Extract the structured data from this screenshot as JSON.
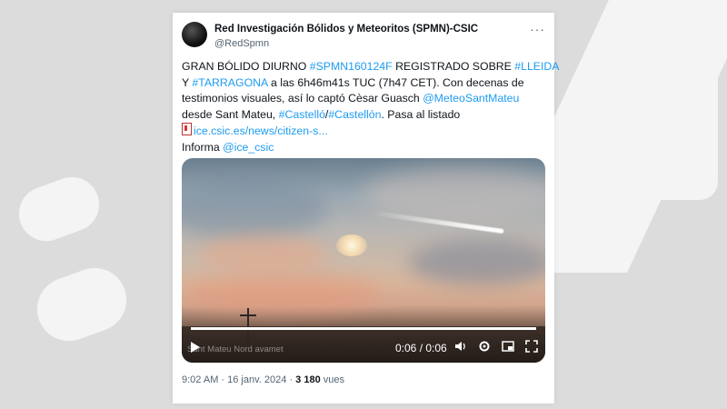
{
  "background": {
    "color": "#dcdcdc",
    "logo_shape_color": "#f4f4f4"
  },
  "tweet": {
    "author": {
      "name": "Red Investigación Bólidos y Meteoritos (SPMN)-CSIC",
      "handle": "@RedSpmn"
    },
    "more_label": "···",
    "lines": [
      [
        {
          "t": "GRAN BÓLIDO DIURNO "
        },
        {
          "t": "#SPMN160124F",
          "link": true
        },
        {
          "t": " REGISTRADO SOBRE "
        },
        {
          "t": "#LLEIDA",
          "link": true
        }
      ],
      [
        {
          "t": "Y "
        },
        {
          "t": "#TARRAGONA",
          "link": true
        },
        {
          "t": " a las 6h46m41s TUC (7h47 CET). Con decenas de"
        }
      ],
      [
        {
          "t": "testimonios visuales, así lo captó Cèsar Guasch "
        },
        {
          "t": "@MeteoSantMateu",
          "link": true
        }
      ],
      [
        {
          "t": "desde Sant Mateu, "
        },
        {
          "t": "#Castelló",
          "link": true
        },
        {
          "t": "/"
        },
        {
          "t": "#Castellón",
          "link": true
        },
        {
          "t": ". Pasa al listado"
        }
      ],
      [
        {
          "icon": "document-icon"
        },
        {
          "t": "ice.csic.es/news/citizen-s...",
          "link": true
        }
      ],
      [
        {
          "t": "Informa "
        },
        {
          "t": "@ice_csic",
          "link": true
        }
      ]
    ],
    "video": {
      "watermark": "Sant Mateu Nord avamet",
      "time": "0:06 / 0:06",
      "progress": 1.0,
      "controls": [
        "play-icon",
        "volume-icon",
        "settings-icon",
        "pip-icon",
        "fullscreen-icon"
      ]
    },
    "footer": {
      "time": "9:02 AM",
      "sep": " · ",
      "date": "16 janv. 2024",
      "sep2": " · ",
      "views": "3 180",
      "views_label": " vues"
    },
    "link_color": "#1d9bf0"
  }
}
